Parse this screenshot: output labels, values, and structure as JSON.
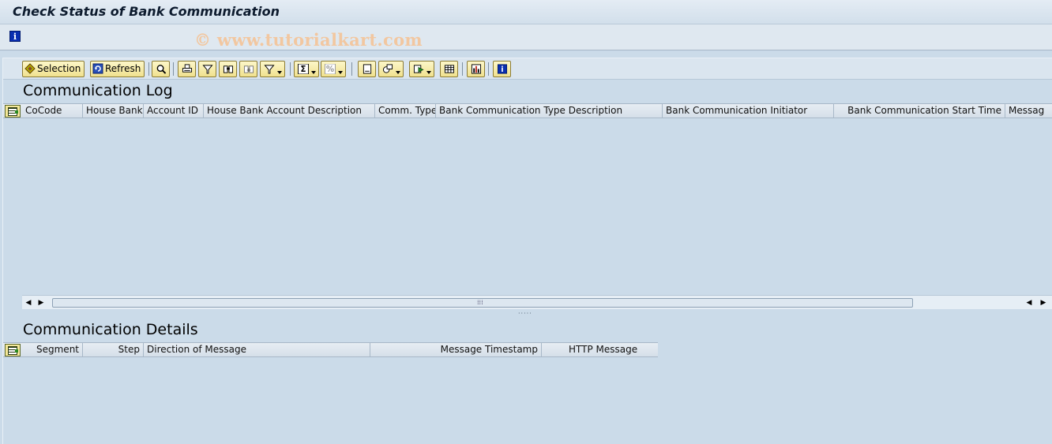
{
  "window": {
    "title": "Check Status of Bank Communication"
  },
  "app_toolbar": {
    "info_icon": "info-icon",
    "watermark": "© www.tutorialkart.com"
  },
  "alv_toolbar": {
    "selection_label": "Selection",
    "refresh_label": "Refresh",
    "icons": [
      "details-icon",
      "print-icon",
      "filter-icon",
      "find-icon",
      "find-next-icon",
      "set-filter-icon",
      "sum-icon",
      "subtotal-icon",
      "print-preview-icon",
      "views-icon",
      "export-icon",
      "layout-icon",
      "graphics-icon",
      "info-icon"
    ]
  },
  "log": {
    "title": "Communication Log",
    "columns": [
      "CoCode",
      "House Bank",
      "Account ID",
      "House Bank Account Description",
      "Comm. Type",
      "Bank Communication Type Description",
      "Bank Communication Initiator",
      "Bank Communication Start Time",
      "Messag"
    ],
    "rows": []
  },
  "details": {
    "title": "Communication Details",
    "columns": [
      "Segment",
      "Step",
      "Direction of Message",
      "Message Timestamp",
      "HTTP Message"
    ],
    "rows": []
  },
  "colors": {
    "background": "#cbdbe9",
    "button": "#f5e89a",
    "info_blue": "#0a2fb0"
  }
}
